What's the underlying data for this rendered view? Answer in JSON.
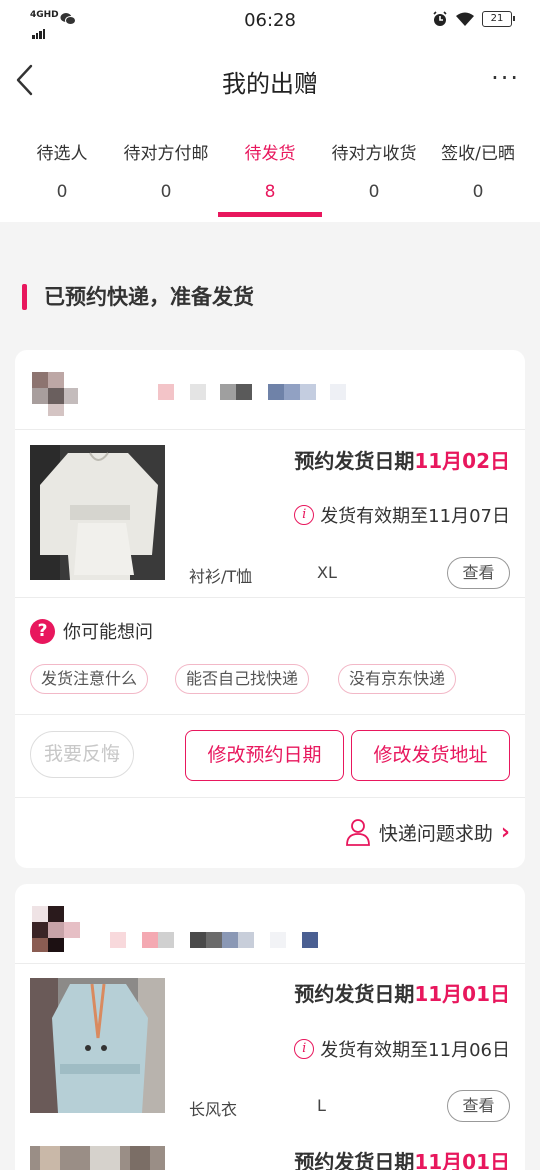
{
  "status_bar": {
    "network": "4GHD",
    "time": "06:28",
    "battery": "21"
  },
  "header": {
    "title": "我的出赠",
    "more_label": "···"
  },
  "tabs": [
    {
      "label": "待选人",
      "count": "0",
      "active": false
    },
    {
      "label": "待对方付邮",
      "count": "0",
      "active": false
    },
    {
      "label": "待发货",
      "count": "8",
      "active": true
    },
    {
      "label": "待对方收货",
      "count": "0",
      "active": false
    },
    {
      "label": "签收/已晒",
      "count": "0",
      "active": false
    }
  ],
  "section_title": "已预约快递，准备发货",
  "orders": [
    {
      "date_label": "预约发货日期",
      "date_value": "11月02日",
      "valid_text": "发货有效期至11月07日",
      "category": "衬衫/T恤",
      "size": "XL",
      "view_label": "查看",
      "faq_title": "你可能想问",
      "faq_chips": [
        "发货注意什么",
        "能否自己找快递",
        "没有京东快递"
      ],
      "regret_label": "我要反悔",
      "change_date_label": "修改预约日期",
      "change_address_label": "修改发货地址",
      "help_label": "快递问题求助"
    },
    {
      "date_label": "预约发货日期",
      "date_value": "11月01日",
      "valid_text": "发货有效期至11月06日",
      "category": "长风衣",
      "size": "L",
      "view_label": "查看"
    },
    {
      "date_label": "预约发货日期",
      "date_value": "11月01日"
    }
  ],
  "colors": {
    "accent": "#e8175d",
    "background": "#f4f4f4",
    "card": "#ffffff"
  },
  "icons": [
    "back-arrow-icon",
    "more-icon",
    "info-icon",
    "question-icon",
    "user-icon",
    "chevron-right-icon",
    "wifi-icon",
    "alarm-icon",
    "wechat-icon",
    "signal-icon"
  ]
}
